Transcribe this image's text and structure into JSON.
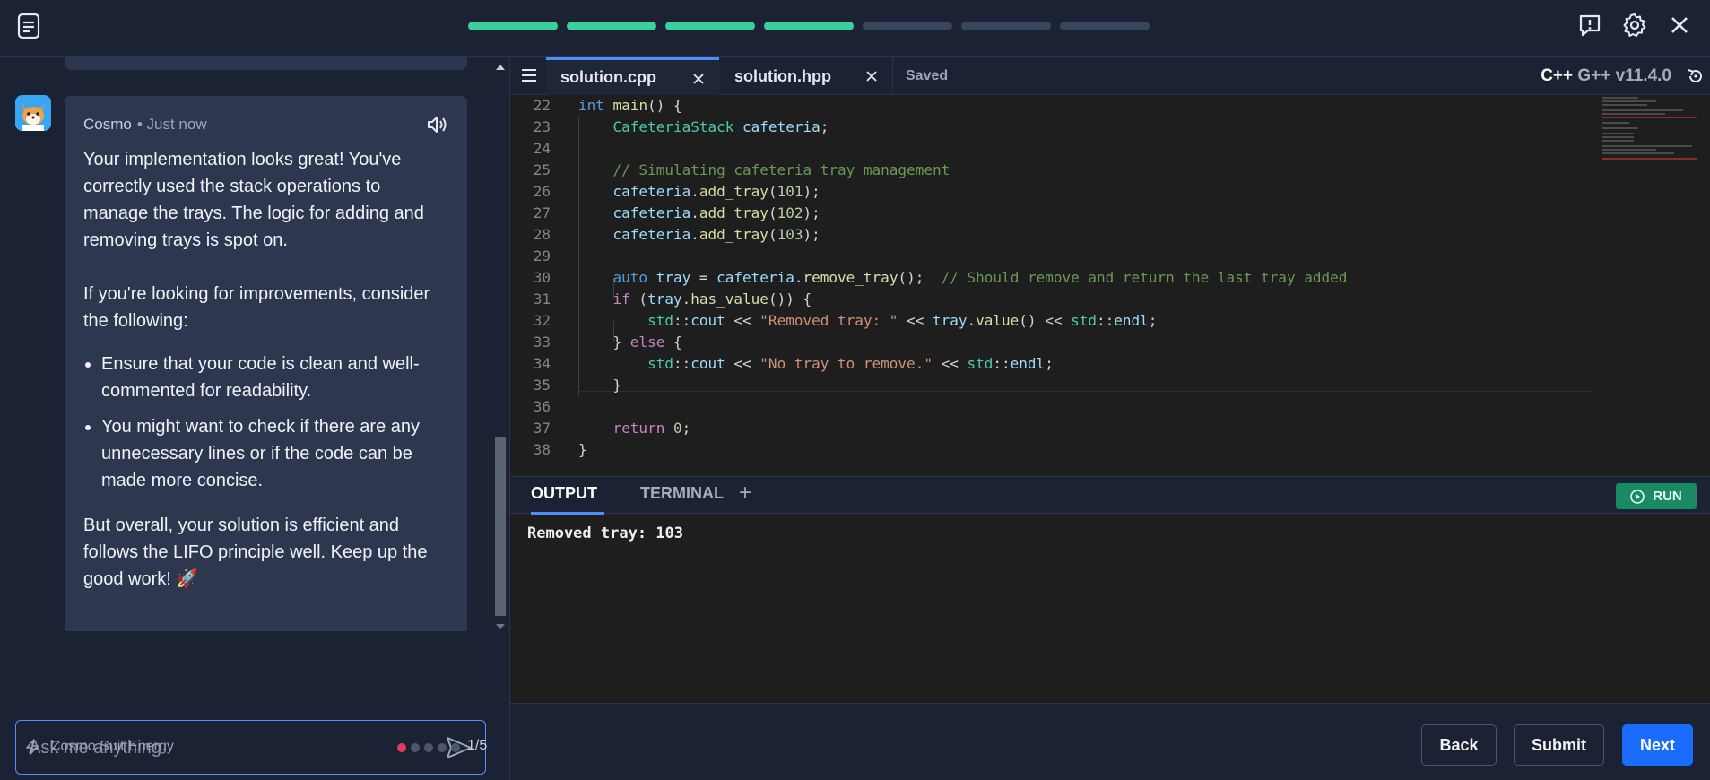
{
  "topbar": {
    "progress": [
      true,
      true,
      true,
      true,
      false,
      false,
      false
    ],
    "icons": [
      "notes-icon",
      "report-icon",
      "gear-icon",
      "close-icon"
    ]
  },
  "chat": {
    "sender": "Cosmo",
    "time": "• Just now",
    "para1": "Your implementation looks great! You've correctly used the stack operations to manage the trays. The logic for adding and removing trays is spot on.",
    "para2": "If you're looking for improvements, consider the following:",
    "bullets": [
      "Ensure that your code is clean and well-commented for readability.",
      "You might want to check if there are any unnecessary lines or if the code can be made more concise."
    ],
    "para3": "But overall, your solution is efficient and follows the LIFO principle well. Keep up the good work! 🚀",
    "input_placeholder": "Ask me anything",
    "energy_label": "Cosmo Suit Energy",
    "energy_dots": 5,
    "energy_active": 1,
    "pager": "1/5"
  },
  "editor": {
    "tabs": [
      "solution.cpp",
      "solution.hpp"
    ],
    "saved": "Saved",
    "lang_main": "C++",
    "lang_version": "G++ v11.4.0",
    "lines": [
      {
        "n": "22",
        "html": "<span class='kw'>int</span> <span class='fn'>main</span>() {"
      },
      {
        "n": "23",
        "html": "    <span class='ty'>CafeteriaStack</span> <span class='var'>cafeteria</span>;"
      },
      {
        "n": "24",
        "html": ""
      },
      {
        "n": "25",
        "html": "    <span class='cmt'>// Simulating cafeteria tray management</span>"
      },
      {
        "n": "26",
        "html": "    <span class='var'>cafeteria</span>.<span class='fn'>add_tray</span>(<span class='num'>101</span>);"
      },
      {
        "n": "27",
        "html": "    <span class='var'>cafeteria</span>.<span class='fn'>add_tray</span>(<span class='num'>102</span>);"
      },
      {
        "n": "28",
        "html": "    <span class='var'>cafeteria</span>.<span class='fn'>add_tray</span>(<span class='num'>103</span>);"
      },
      {
        "n": "29",
        "html": ""
      },
      {
        "n": "30",
        "html": "    <span class='kw'>auto</span> <span class='var'>tray</span> = <span class='var'>cafeteria</span>.<span class='fn'>remove_tray</span>();  <span class='cmt'>// Should remove and return the last tray added</span>"
      },
      {
        "n": "31",
        "html": "    <span class='kw2'>if</span> (<span class='var'>tray</span>.<span class='fn'>has_value</span>()) {"
      },
      {
        "n": "32",
        "html": "        <span class='ty'>std</span>::<span class='var'>cout</span> &lt;&lt; <span class='str'>\"Removed tray: \"</span> &lt;&lt; <span class='var'>tray</span>.<span class='fn'>value</span>() &lt;&lt; <span class='ty'>std</span>::<span class='var'>endl</span>;"
      },
      {
        "n": "33",
        "html": "    } <span class='kw2'>else</span> {"
      },
      {
        "n": "34",
        "html": "        <span class='ty'>std</span>::<span class='var'>cout</span> &lt;&lt; <span class='str'>\"No tray to remove.\"</span> &lt;&lt; <span class='ty'>std</span>::<span class='var'>endl</span>;"
      },
      {
        "n": "35",
        "html": "    }"
      },
      {
        "n": "36",
        "html": ""
      },
      {
        "n": "37",
        "html": "    <span class='kw2'>return</span> <span class='num'>0</span>;"
      },
      {
        "n": "38",
        "html": "}"
      }
    ]
  },
  "output": {
    "tabs": [
      "OUTPUT",
      "TERMINAL"
    ],
    "add": "+",
    "run_label": "RUN",
    "text": "Removed tray: 103"
  },
  "footer": {
    "back": "Back",
    "submit": "Submit",
    "next": "Next"
  },
  "colors": {
    "accent": "#1a6cff",
    "progress_done": "#3ad09b",
    "run": "#1a8a62",
    "energy_active": "#e83a5a"
  }
}
